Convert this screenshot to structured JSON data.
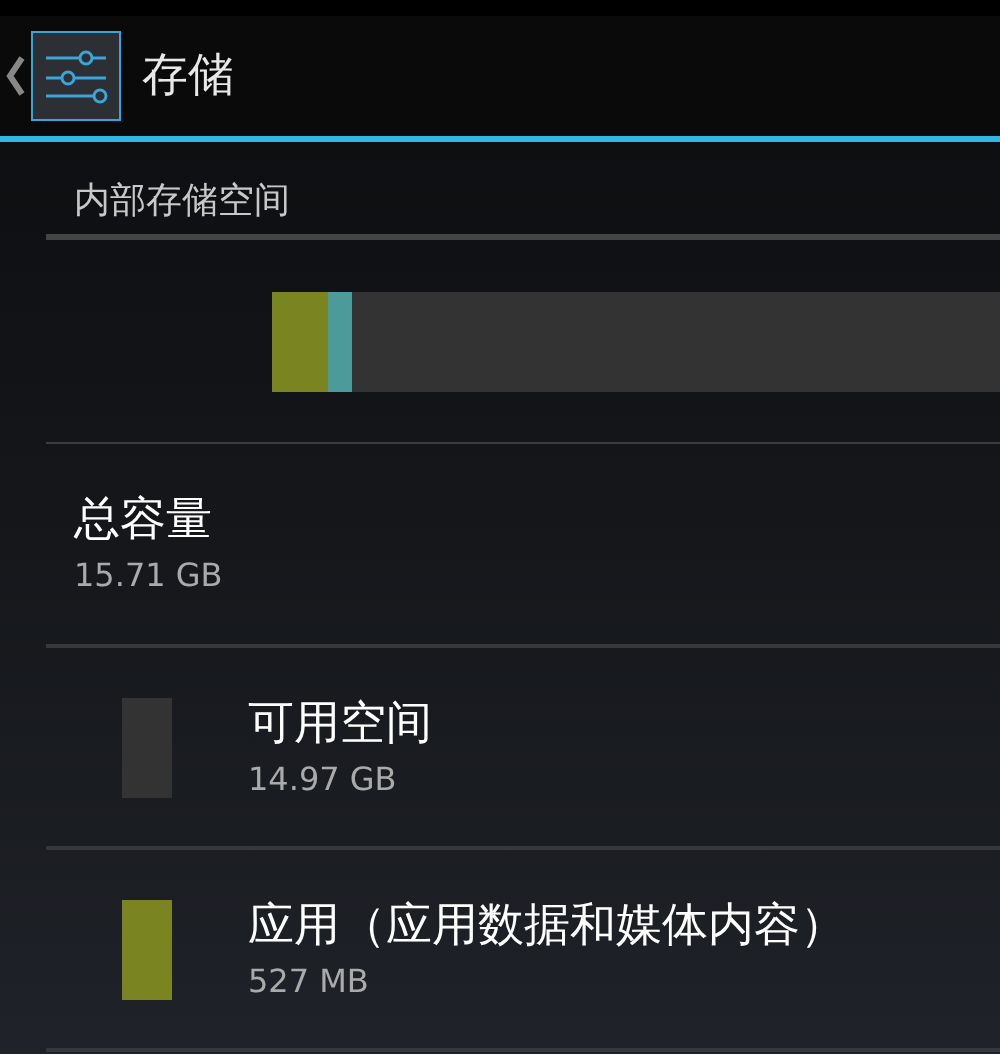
{
  "action_bar": {
    "title": "存储"
  },
  "section": {
    "title": "内部存储空间"
  },
  "usage_bar": {
    "segments": [
      {
        "color": "#7a8420",
        "level": 0.07
      },
      {
        "color": "#4d9a9a",
        "level": 0.03
      }
    ]
  },
  "total": {
    "title": "总容量",
    "summary": "15.71 GB"
  },
  "items": [
    {
      "title": "可用空间",
      "summary": "14.97 GB",
      "color": "#333333"
    },
    {
      "title": "应用（应用数据和媒体内容）",
      "summary": "527 MB",
      "color": "#7a8420"
    }
  ]
}
